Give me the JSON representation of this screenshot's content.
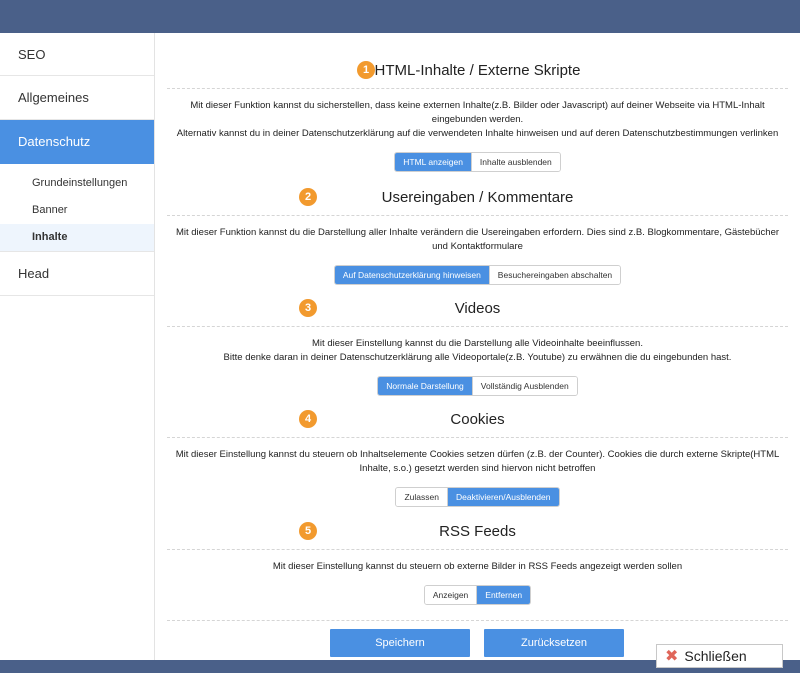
{
  "sidebar": {
    "items": [
      {
        "label": "SEO"
      },
      {
        "label": "Allgemeines"
      },
      {
        "label": "Datenschutz"
      },
      {
        "label": "Head"
      }
    ],
    "sub_items": [
      {
        "label": "Grundeinstellungen"
      },
      {
        "label": "Banner"
      },
      {
        "label": "Inhalte"
      }
    ]
  },
  "sections": [
    {
      "number": "1",
      "title": "HTML-Inhalte / Externe Skripte",
      "description_lines": [
        "Mit dieser Funktion kannst du sicherstellen, dass keine externen Inhalte(z.B. Bilder oder Javascript) auf deiner Webseite via HTML-Inhalt",
        "eingebunden werden.",
        "Alternativ kannst du in deiner Datenschutzerklärung auf die verwendeten Inhalte hinweisen und auf deren Datenschutzbestimmungen verlinken"
      ],
      "options": [
        "HTML anzeigen",
        "Inhalte ausblenden"
      ],
      "selected": 0
    },
    {
      "number": "2",
      "title": "Usereingaben / Kommentare",
      "description_lines": [
        "Mit dieser Funktion kannst du die Darstellung aller Inhalte verändern die Usereingaben erfordern. Dies sind z.B. Blogkommentare, Gästebücher",
        "und Kontaktformulare"
      ],
      "options": [
        "Auf Datenschutzerklärung hinweisen",
        "Besuchereingaben abschalten"
      ],
      "selected": 0
    },
    {
      "number": "3",
      "title": "Videos",
      "description_lines": [
        "Mit dieser Einstellung kannst du die Darstellung alle Videoinhalte beeinflussen.",
        "Bitte denke daran in deiner Datenschutzerklärung alle Videoportale(z.B. Youtube) zu erwähnen die du eingebunden hast."
      ],
      "options": [
        "Normale Darstellung",
        "Vollständig Ausblenden"
      ],
      "selected": 0
    },
    {
      "number": "4",
      "title": "Cookies",
      "description_lines": [
        "Mit dieser Einstellung kannst du steuern ob Inhaltselemente Cookies setzen dürfen (z.B. der Counter). Cookies die durch externe Skripte(HTML",
        "Inhalte, s.o.) gesetzt werden sind hiervon nicht betroffen"
      ],
      "options": [
        "Zulassen",
        "Deaktivieren/Ausblenden"
      ],
      "selected": 1
    },
    {
      "number": "5",
      "title": "RSS Feeds",
      "description_lines": [
        "Mit dieser Einstellung kannst du steuern ob externe Bilder in RSS Feeds angezeigt werden sollen"
      ],
      "options": [
        "Anzeigen",
        "Entfernen"
      ],
      "selected": 1
    }
  ],
  "actions": {
    "save_label": "Speichern",
    "reset_label": "Zurücksetzen"
  },
  "close": {
    "label": "Schließen",
    "icon": "close-icon"
  },
  "colors": {
    "accent": "#4a90e2",
    "badge": "#f29a2e",
    "frame": "#4a6089"
  }
}
